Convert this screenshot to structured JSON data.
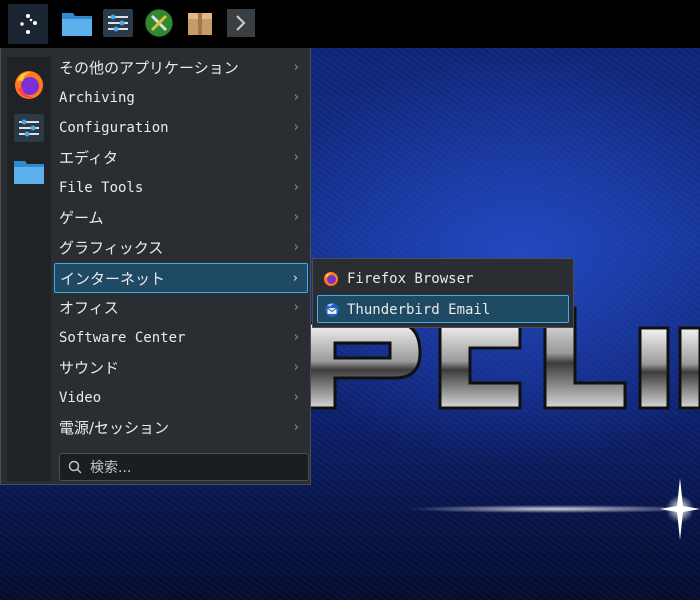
{
  "taskbar": {
    "items": [
      {
        "name": "application-launcher",
        "icon": "launcher-dots-icon"
      },
      {
        "name": "file-manager",
        "icon": "folder-icon"
      },
      {
        "name": "system-settings",
        "icon": "sliders-icon"
      },
      {
        "name": "tools",
        "icon": "wrench-screwdriver-icon"
      },
      {
        "name": "package-manager",
        "icon": "package-box-icon"
      },
      {
        "name": "terminal",
        "icon": "terminal-icon"
      }
    ]
  },
  "menu": {
    "favorites": [
      {
        "icon": "firefox-icon"
      },
      {
        "icon": "sliders-icon"
      },
      {
        "icon": "folder-icon"
      }
    ],
    "categories": [
      {
        "label": "その他のアプリケーション"
      },
      {
        "label": "Archiving"
      },
      {
        "label": "Configuration"
      },
      {
        "label": "エディタ"
      },
      {
        "label": "File Tools"
      },
      {
        "label": "ゲーム"
      },
      {
        "label": "グラフィックス"
      },
      {
        "label": "インターネット",
        "selected": true
      },
      {
        "label": "オフィス"
      },
      {
        "label": "Software Center"
      },
      {
        "label": "サウンド"
      },
      {
        "label": "Video"
      },
      {
        "label": "電源/セッション"
      }
    ],
    "chevron": "›",
    "search": {
      "placeholder": "検索..."
    }
  },
  "submenu": {
    "items": [
      {
        "label": "Firefox Browser",
        "icon": "firefox-icon"
      },
      {
        "label": "Thunderbird Email",
        "icon": "thunderbird-icon",
        "selected": true
      }
    ]
  },
  "colors": {
    "menu_bg": "#2a2e32",
    "highlight_bg": "#1e4a63",
    "highlight_border": "#3daee9",
    "taskbar_bg": "#000000"
  }
}
